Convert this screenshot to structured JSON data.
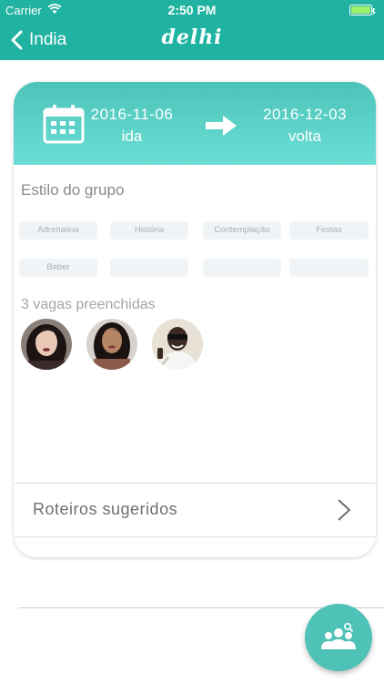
{
  "status_bar": {
    "carrier": "Carrier",
    "time": "2:50 PM"
  },
  "nav": {
    "back_label": "India",
    "title": "delhi"
  },
  "trip": {
    "start": {
      "date": "2016-11-06",
      "label": "ida"
    },
    "end": {
      "date": "2016-12-03",
      "label": "volta"
    }
  },
  "group_style": {
    "title": "Estilo do grupo",
    "tags": [
      "Adrenalina",
      "História",
      "Contemplação",
      "Festas",
      "Beber",
      "",
      "",
      ""
    ]
  },
  "members": {
    "title": "3 vagas preenchidas",
    "avatars": [
      "avatar-woman-dark-hair",
      "avatar-woman-long-hair",
      "avatar-man-sunglasses"
    ]
  },
  "roteiros": {
    "label": "Roteiros sugeridos"
  },
  "colors": {
    "primary": "#21b3a1",
    "header_light": "#6bdfd6",
    "fab": "#4ec2b6"
  },
  "fab": {
    "icon": "group-search-icon"
  }
}
